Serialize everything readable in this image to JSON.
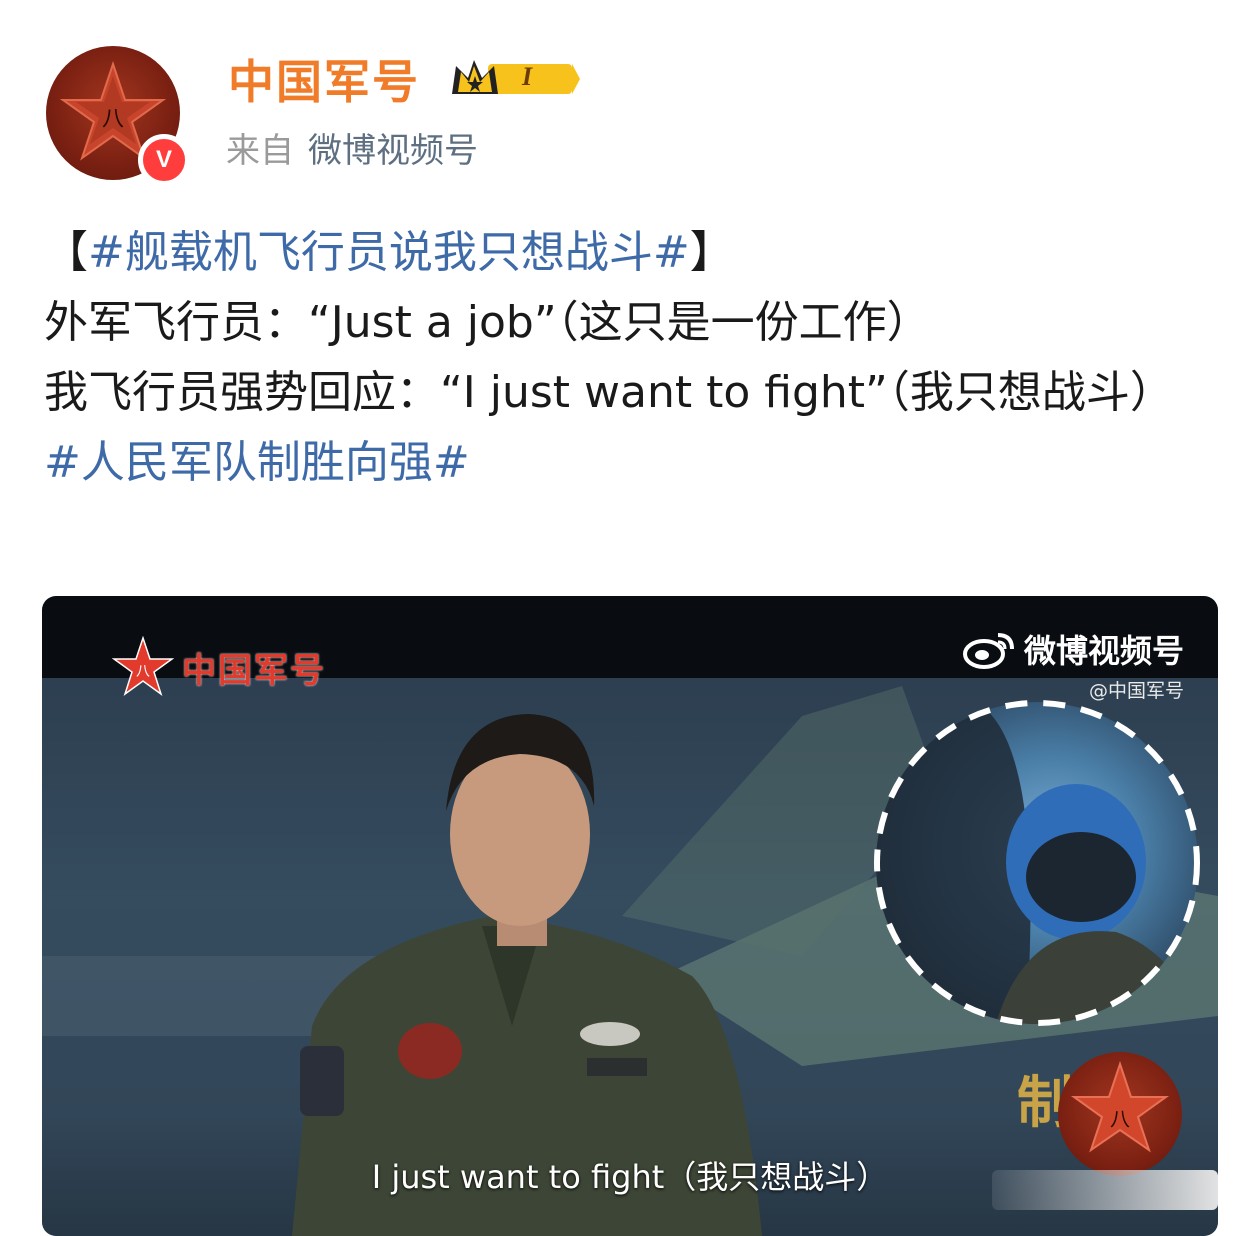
{
  "header": {
    "account_name": "中国军号",
    "level_badge": "I",
    "source_prefix": "来自",
    "source_channel": "微博视频号",
    "verified_icon": "verified-v-icon",
    "avatar_icon": "army-star-emblem-icon"
  },
  "post": {
    "line1_open": "【",
    "line1_topic": "#舰载机飞行员说我只想战斗#",
    "line1_close": "】",
    "line2": "外军飞行员：“Just a job”（这只是一份工作）",
    "line3": "我飞行员强势回应：“I just want to fight”（我只想战斗）",
    "line4_topic": "#人民军队制胜向强#"
  },
  "video": {
    "watermark_left": "中国军号",
    "watermark_right_brand": "微博视频号",
    "watermark_right_handle": "@中国军号",
    "subtitle": "I just want to fight（我只想战斗）",
    "corner_char": "制"
  },
  "colors": {
    "account_name": "#f07c2a",
    "topic": "#3e6aa8",
    "verified": "#ff3d3d",
    "channel": "#5f6f82"
  }
}
